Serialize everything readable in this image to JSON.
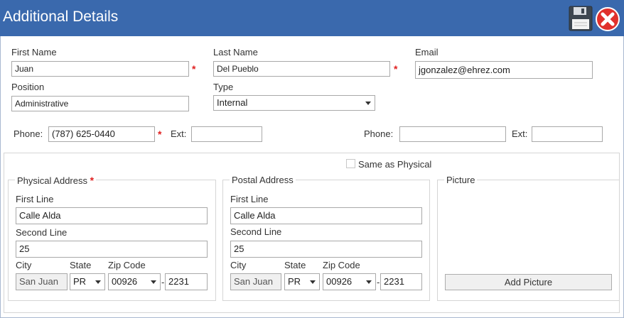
{
  "window": {
    "title": "Additional Details",
    "save_icon": "floppy-disk-icon",
    "close_icon": "red-circle-x-icon"
  },
  "contact": {
    "first_name_label": "First Name",
    "first_name_value": "Juan",
    "last_name_label": "Last Name",
    "last_name_value": "Del Pueblo",
    "email_label": "Email",
    "email_value": "jgonzalez@ehrez.com",
    "position_label": "Position",
    "position_value": "Administrative",
    "type_label": "Type",
    "type_value": "Internal",
    "required_mark": "*"
  },
  "phones": {
    "phone1_label": "Phone:",
    "phone1_value": "(787) 625-0440",
    "ext1_label": "Ext:",
    "ext1_value": "",
    "phone2_label": "Phone:",
    "phone2_value": "",
    "ext2_label": "Ext:",
    "ext2_value": ""
  },
  "same_as_physical": {
    "label": "Same as Physical",
    "checked": false
  },
  "physical": {
    "title": "Physical Address",
    "first_line_label": "First Line",
    "first_line_value": "Calle Alda",
    "second_line_label": "Second Line",
    "second_line_value": "25",
    "city_label": "City",
    "city_value": "San Juan",
    "state_label": "State",
    "state_value": "PR",
    "zip_label": "Zip Code",
    "zip_value": "00926",
    "zip_sep": "-",
    "zip_ext_value": "2231"
  },
  "postal": {
    "title": "Postal Address",
    "first_line_label": "First Line",
    "first_line_value": "Calle Alda",
    "second_line_label": "Second Line",
    "second_line_value": "25",
    "city_label": "City",
    "city_value": "San Juan",
    "state_label": "State",
    "state_value": "PR",
    "zip_label": "Zip Code",
    "zip_value": "00926",
    "zip_sep": "-",
    "zip_ext_value": "2231"
  },
  "picture": {
    "title": "Picture",
    "add_button": "Add Picture"
  },
  "colors": {
    "titlebar": "#3a69ad",
    "required": "#e02020",
    "close_red": "#e0302c"
  }
}
